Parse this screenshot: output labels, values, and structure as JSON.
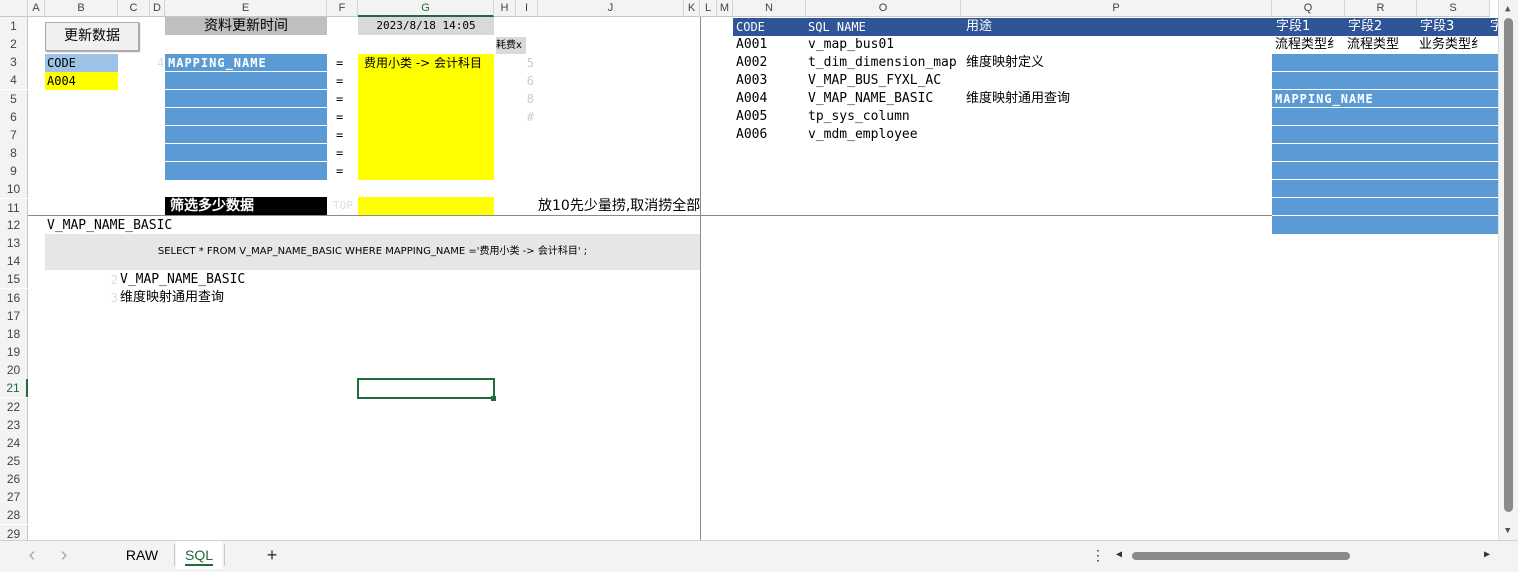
{
  "columns": [
    "A",
    "B",
    "C",
    "D",
    "E",
    "F",
    "G",
    "H",
    "I",
    "J",
    "K",
    "L",
    "M",
    "N",
    "O",
    "P",
    "Q",
    "R",
    "S"
  ],
  "rows": [
    "1",
    "2",
    "3",
    "4",
    "5",
    "6",
    "7",
    "8",
    "9",
    "10",
    "11",
    "12",
    "13",
    "14",
    "15",
    "16",
    "17",
    "18",
    "19",
    "20",
    "21",
    "22",
    "23",
    "24",
    "25",
    "26",
    "27",
    "28",
    "29"
  ],
  "update_button": "更新数据",
  "update_time_label": "资料更新时间",
  "update_time_value": "2023/8/18 14:05",
  "elapsed_label": "耗费x",
  "code_header": "CODE",
  "code_value": "A004",
  "filter_field": "MAPPING_NAME",
  "faint_num_e3": "4",
  "equals": [
    "=",
    "=",
    "=",
    "=",
    "=",
    "=",
    "="
  ],
  "filter_value": "费用小类 -> 会计科目",
  "faint_nums_h": [
    "5",
    "6",
    "8",
    "#"
  ],
  "top_label": "筛选多少数据",
  "top_faint": "TOP",
  "top_note": "放10先少量捞,取消捞全部",
  "view_name": "V_MAP_NAME_BASIC",
  "sql_text": "SELECT * FROM V_MAP_NAME_BASIC WHERE MAPPING_NAME ='费用小类 -> 会计科目' ;",
  "faint_2": "2",
  "faint_3": "3",
  "result_view": "V_MAP_NAME_BASIC",
  "result_desc": "维度映射通用查询",
  "table_headers": {
    "code": "CODE",
    "sql_name": "SQL NAME",
    "purpose": "用途",
    "f1": "字段1",
    "f2": "字段2",
    "f3": "字段3",
    "f4": "字"
  },
  "table_rows": [
    {
      "code": "A001",
      "name": "v_map_bus01",
      "purpose": ""
    },
    {
      "code": "A002",
      "name": "t_dim_dimension_map",
      "purpose": "维度映射定义"
    },
    {
      "code": "A003",
      "name": "V_MAP_BUS_FYXL_AC",
      "purpose": ""
    },
    {
      "code": "A004",
      "name": "V_MAP_NAME_BASIC",
      "purpose": "维度映射通用查询"
    },
    {
      "code": "A005",
      "name": "tp_sys_column",
      "purpose": ""
    },
    {
      "code": "A006",
      "name": "v_mdm_employee",
      "purpose": ""
    }
  ],
  "field_row1": {
    "q": "流程类型纟",
    "r": "流程类型",
    "s": "业务类型纟"
  },
  "field_mapping": "MAPPING_NAME",
  "tabs": {
    "raw": "RAW",
    "sql": "SQL",
    "add": "+"
  },
  "nav": {
    "prev": "‹",
    "next": "›",
    "more": "⋮",
    "scroll_left": "◀",
    "scroll_right": "▶"
  }
}
